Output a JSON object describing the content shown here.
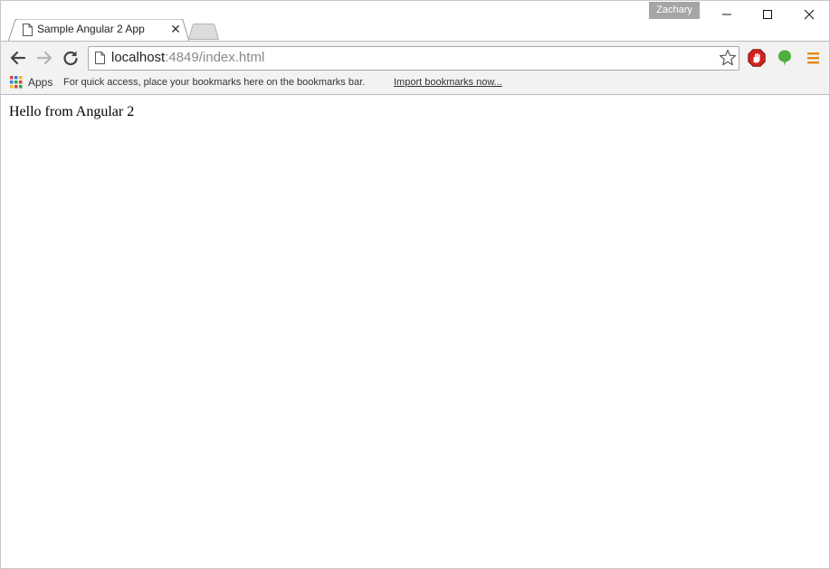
{
  "window": {
    "profile_name": "Zachary"
  },
  "tab": {
    "title": "Sample Angular 2 App",
    "close_glyph": "✕"
  },
  "omnibox": {
    "host": "localhost",
    "path": ":4849/index.html"
  },
  "bookmarks_bar": {
    "apps_label": "Apps",
    "hint": "For quick access, place your bookmarks here on the bookmarks bar.",
    "import_link": "Import bookmarks now..."
  },
  "page": {
    "text": "Hello from Angular 2"
  },
  "colors": {
    "adblock_red": "#d22222",
    "evernote_green": "#4caf3b",
    "menu_orange": "#e38a13"
  },
  "icons": [
    "page-icon",
    "back-icon",
    "forward-icon",
    "reload-icon",
    "star-icon",
    "adblock-icon",
    "evernote-icon",
    "menu-icon",
    "apps-grid-icon",
    "minimize-icon",
    "maximize-icon",
    "close-icon"
  ]
}
